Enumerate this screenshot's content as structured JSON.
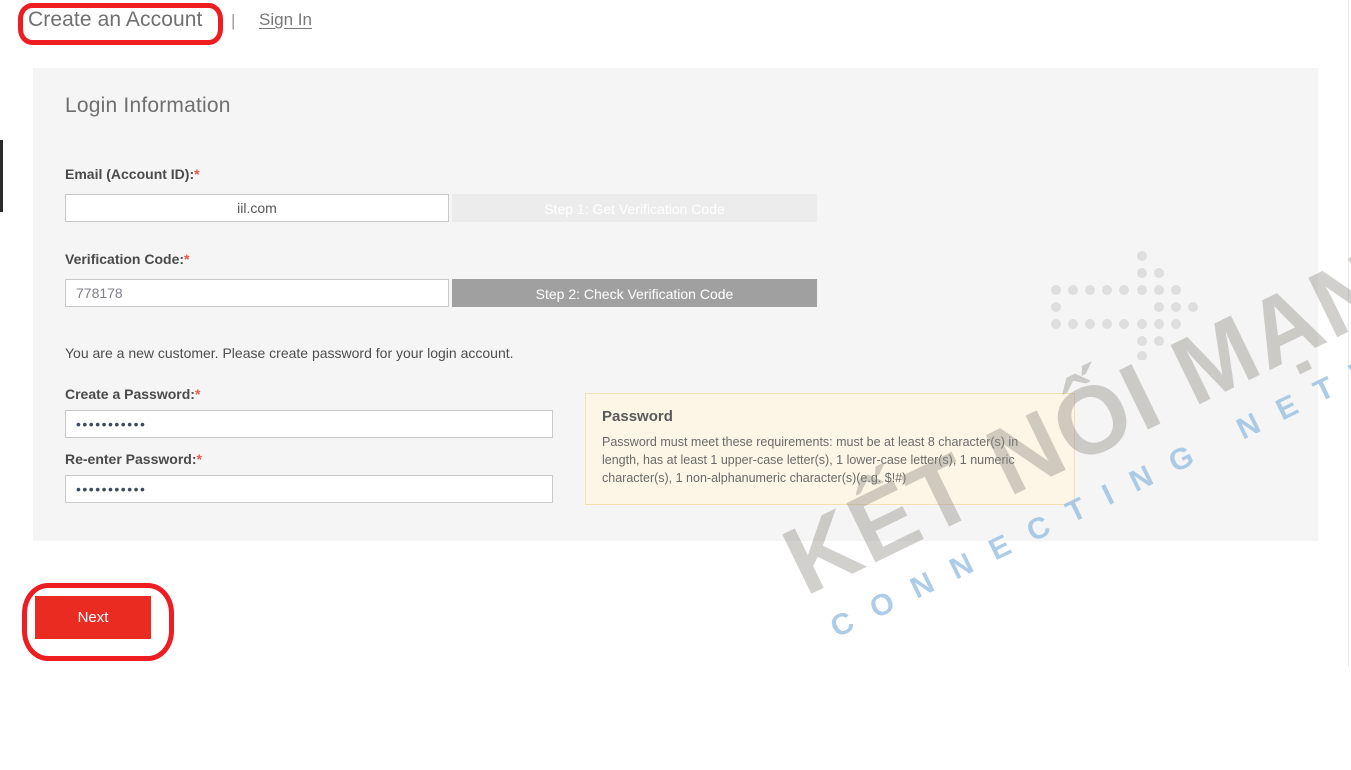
{
  "header": {
    "tab_create_account": "Create an Account",
    "separator": "|",
    "link_sign_in": "Sign In"
  },
  "panel": {
    "title": "Login Information",
    "fields": {
      "email": {
        "label": "Email (Account ID):",
        "required_marker": "*",
        "value": "iil.com",
        "placeholder": ""
      },
      "verification_code": {
        "label": "Verification Code:",
        "required_marker": "*",
        "value": "778178",
        "placeholder": ""
      },
      "create_password": {
        "label": "Create a Password:",
        "required_marker": "*",
        "value": "•••••••••••",
        "placeholder": ""
      },
      "reenter_password": {
        "label": "Re-enter Password:",
        "required_marker": "*",
        "value": "•••••••••••",
        "placeholder": ""
      }
    },
    "buttons": {
      "step1": "Step 1: Get Verification Code",
      "step2": "Step 2: Check Verification Code"
    },
    "new_customer_note": "You are a new customer. Please create password for your login account.",
    "password_hint": {
      "title": "Password",
      "body": "Password must meet these requirements: must be at least 8 character(s) in length, has at least 1 upper-case letter(s), 1 lower-case letter(s), 1 numeric character(s), 1 non-alphanumeric character(s)(e.g. $!#)"
    }
  },
  "footer": {
    "next_button": "Next"
  },
  "watermark": {
    "main": "KẾT NỐI MẠNG",
    "sub": "CONNECTING NETWORKS"
  },
  "colors": {
    "panel_background": "#f5f5f5",
    "accent_red": "#ea2b22",
    "annotation_red": "#ee1d21",
    "step_button_active": "#a0a0a0",
    "step_button_disabled": "#ececec",
    "hint_background": "#fdf6e6",
    "hint_border": "#f2e0b4",
    "required_star": "#e8564a"
  }
}
